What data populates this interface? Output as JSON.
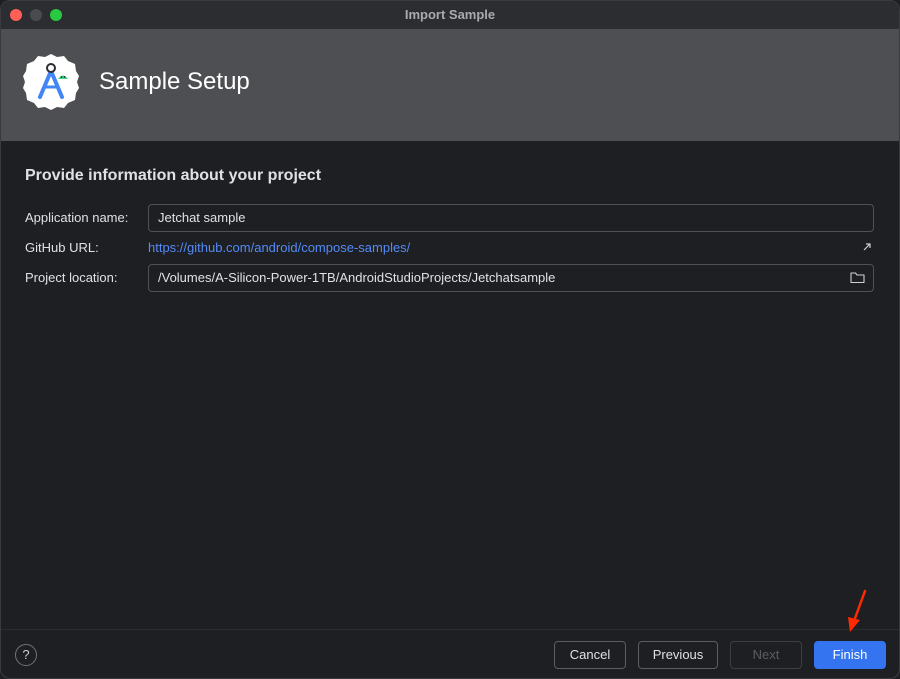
{
  "window": {
    "title": "Import Sample"
  },
  "header": {
    "title": "Sample Setup",
    "logo_icon": "android-studio-logo-icon"
  },
  "form": {
    "heading": "Provide information about your project",
    "app_name_label": "Application name:",
    "app_name_value": "Jetchat sample",
    "github_label": "GitHub URL:",
    "github_url": "https://github.com/android/compose-samples/",
    "location_label": "Project location:",
    "location_value": "/Volumes/A-Silicon-Power-1TB/AndroidStudioProjects/Jetchatsample"
  },
  "footer": {
    "help_label": "?",
    "cancel_label": "Cancel",
    "previous_label": "Previous",
    "next_label": "Next",
    "finish_label": "Finish"
  },
  "colors": {
    "accent": "#3574f0",
    "link": "#548af7",
    "annotation_arrow": "#ff2a00"
  }
}
